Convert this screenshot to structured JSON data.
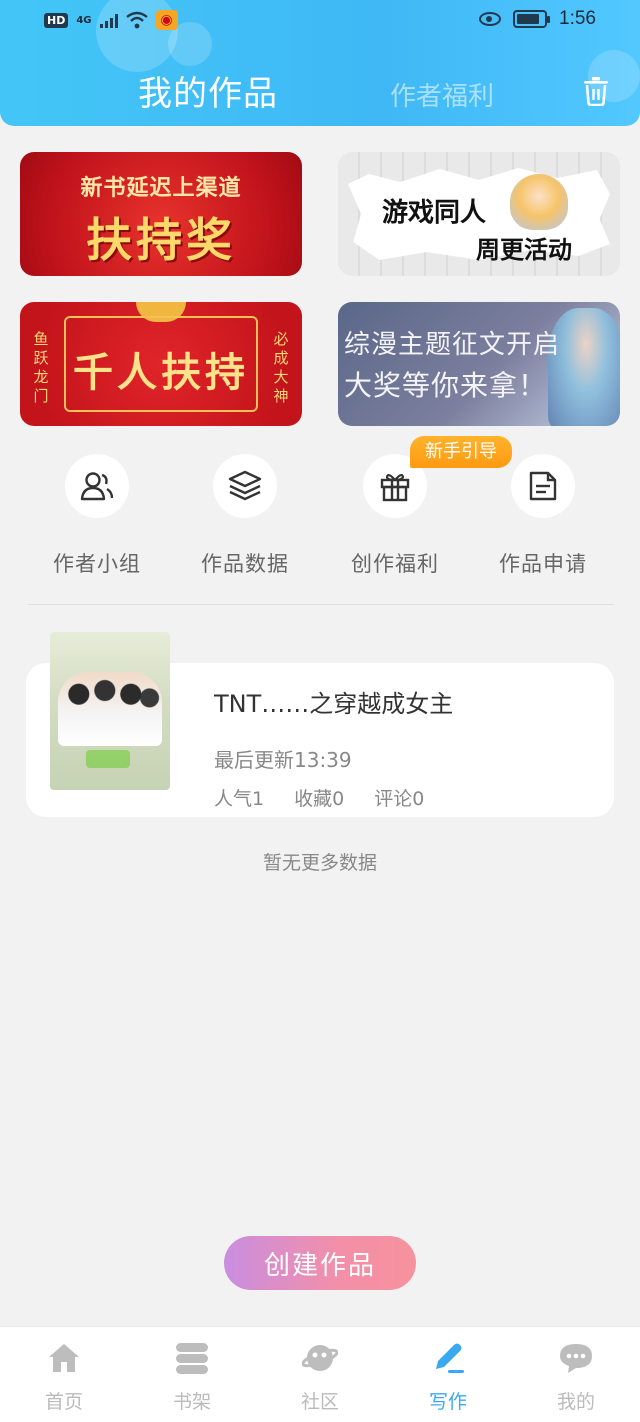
{
  "status_bar": {
    "left_badges": [
      "HD",
      "4G"
    ],
    "time": "1:56",
    "battery_level": 0.85
  },
  "header": {
    "tab_active": "我的作品",
    "tab_inactive": "作者福利",
    "trash_icon": "trash-icon",
    "accent_color": "#43c6f7"
  },
  "banners": [
    {
      "line1": "新书延迟上渠道",
      "line2": "扶持奖"
    },
    {
      "line1": "游戏同人",
      "line2": "周更活动"
    },
    {
      "main": "千人扶持",
      "left_side": "鱼跃龙门",
      "right_side": "必成大神"
    },
    {
      "line1": "综漫主题征文开启",
      "line2": "大奖等你来拿！"
    }
  ],
  "quick_actions": [
    {
      "label": "作者小组",
      "icon": "users-icon"
    },
    {
      "label": "作品数据",
      "icon": "layers-icon"
    },
    {
      "label": "创作福利",
      "icon": "gift-icon"
    },
    {
      "label": "作品申请",
      "icon": "document-icon"
    }
  ],
  "guide_tag": "新手引导",
  "work": {
    "title": "TNT……之穿越成女主",
    "last_update": "最后更新13:39",
    "stats": {
      "popularity": "人气1",
      "favorites": "收藏0",
      "comments": "评论0"
    }
  },
  "no_more": "暂无更多数据",
  "create_button": "创建作品",
  "create_button_colors": [
    "#c98ee0",
    "#f6929c"
  ],
  "bottom_nav": [
    {
      "label": "首页",
      "icon": "home-icon",
      "active": false
    },
    {
      "label": "书架",
      "icon": "bookshelf-icon",
      "active": false
    },
    {
      "label": "社区",
      "icon": "community-icon",
      "active": false
    },
    {
      "label": "写作",
      "icon": "pen-icon",
      "active": true
    },
    {
      "label": "我的",
      "icon": "chat-bubble-icon",
      "active": false
    }
  ],
  "nav_active_color": "#3aa9f2"
}
